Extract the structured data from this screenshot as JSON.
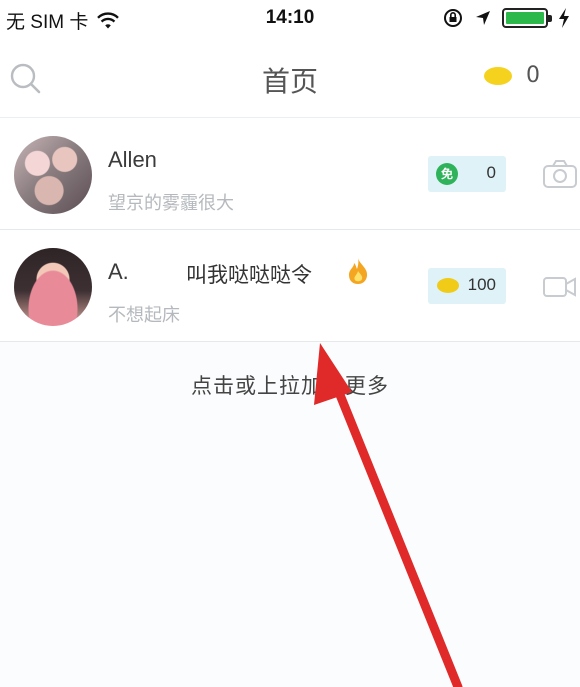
{
  "status_bar": {
    "carrier": "无 SIM 卡",
    "time": "14:10",
    "icons": [
      "wifi-icon",
      "orientation-lock-icon",
      "location-arrow-icon",
      "battery-icon",
      "charging-bolt-icon"
    ]
  },
  "nav": {
    "title": "首页",
    "coin_count": "0",
    "icons": [
      "search-icon",
      "coin-icon"
    ]
  },
  "list": [
    {
      "name": "Allen",
      "status": "",
      "subtitle": "望京的雾霾很大",
      "badge": "免",
      "count": "0",
      "action_icon": "camera-icon"
    },
    {
      "name": "A.",
      "status": "叫我哒哒哒令",
      "subtitle": "不想起床",
      "badge": "",
      "count": "100",
      "action_icon": "video-icon"
    }
  ],
  "load_more": "点击或上拉加载更多",
  "colors": {
    "coin": "#f5d21e",
    "free_badge": "#2fb35a",
    "pill_bg": "#dff2f7",
    "arrow": "#e02a2a",
    "battery": "#2db84b"
  }
}
